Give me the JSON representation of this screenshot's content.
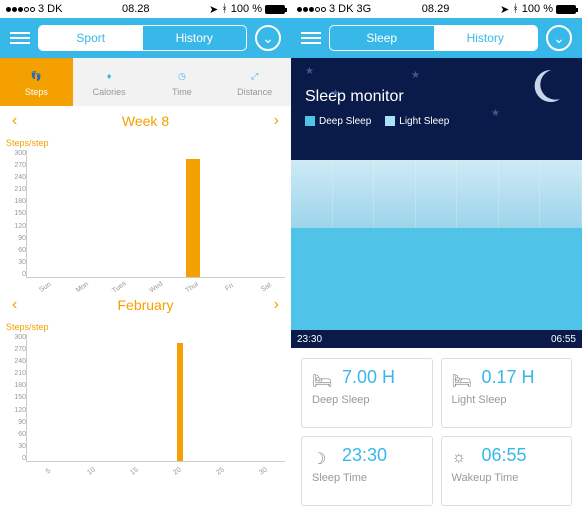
{
  "left": {
    "status": {
      "carrier": "3 DK",
      "time": "08.28",
      "pct": "100 %"
    },
    "seg": {
      "sport": "Sport",
      "history": "History",
      "active": "sport"
    },
    "tabs": [
      {
        "id": "steps",
        "label": "Steps"
      },
      {
        "id": "calories",
        "label": "Calories"
      },
      {
        "id": "time",
        "label": "Time"
      },
      {
        "id": "distance",
        "label": "Distance"
      }
    ],
    "period_top": "Week 8",
    "period_bottom": "February",
    "ylabel": "Steps/step"
  },
  "right": {
    "status": {
      "carrier": "3 DK",
      "net": "3G",
      "time": "08.29",
      "pct": "100 %"
    },
    "seg": {
      "sleep": "Sleep",
      "history": "History",
      "active": "history"
    },
    "title": "Sleep monitor",
    "legend": {
      "deep": "Deep Sleep",
      "light": "Light Sleep"
    },
    "times": {
      "start": "23:30",
      "end": "06:55"
    },
    "cards": {
      "deep": {
        "val": "7.00 H",
        "lbl": "Deep Sleep"
      },
      "light": {
        "val": "0.17 H",
        "lbl": "Light Sleep"
      },
      "sleep": {
        "val": "23:30",
        "lbl": "Sleep Time"
      },
      "wake": {
        "val": "06:55",
        "lbl": "Wakeup Time"
      }
    }
  },
  "chart_data": [
    {
      "type": "bar",
      "title": "Week 8",
      "ylabel": "Steps/step",
      "categories": [
        "Sun",
        "Mon",
        "Tues",
        "Wed",
        "Thur",
        "Fri",
        "Sat"
      ],
      "values": [
        0,
        0,
        0,
        0,
        280,
        0,
        0
      ],
      "ylim": [
        0,
        300
      ],
      "yticks": [
        0,
        30,
        60,
        90,
        120,
        150,
        180,
        210,
        240,
        270,
        300
      ]
    },
    {
      "type": "bar",
      "title": "February",
      "ylabel": "Steps/step",
      "categories": [
        "5",
        "10",
        "15",
        "20",
        "25",
        "30"
      ],
      "values": [
        0,
        0,
        0,
        280,
        0,
        0
      ],
      "bar_day": 19,
      "ylim": [
        0,
        300
      ],
      "yticks": [
        0,
        30,
        60,
        90,
        120,
        150,
        180,
        210,
        240,
        270,
        300
      ]
    },
    {
      "type": "area",
      "title": "Sleep monitor",
      "series": [
        {
          "name": "Deep Sleep",
          "hours": 7.0
        },
        {
          "name": "Light Sleep",
          "hours": 0.17
        }
      ],
      "start": "23:30",
      "end": "06:55"
    }
  ]
}
